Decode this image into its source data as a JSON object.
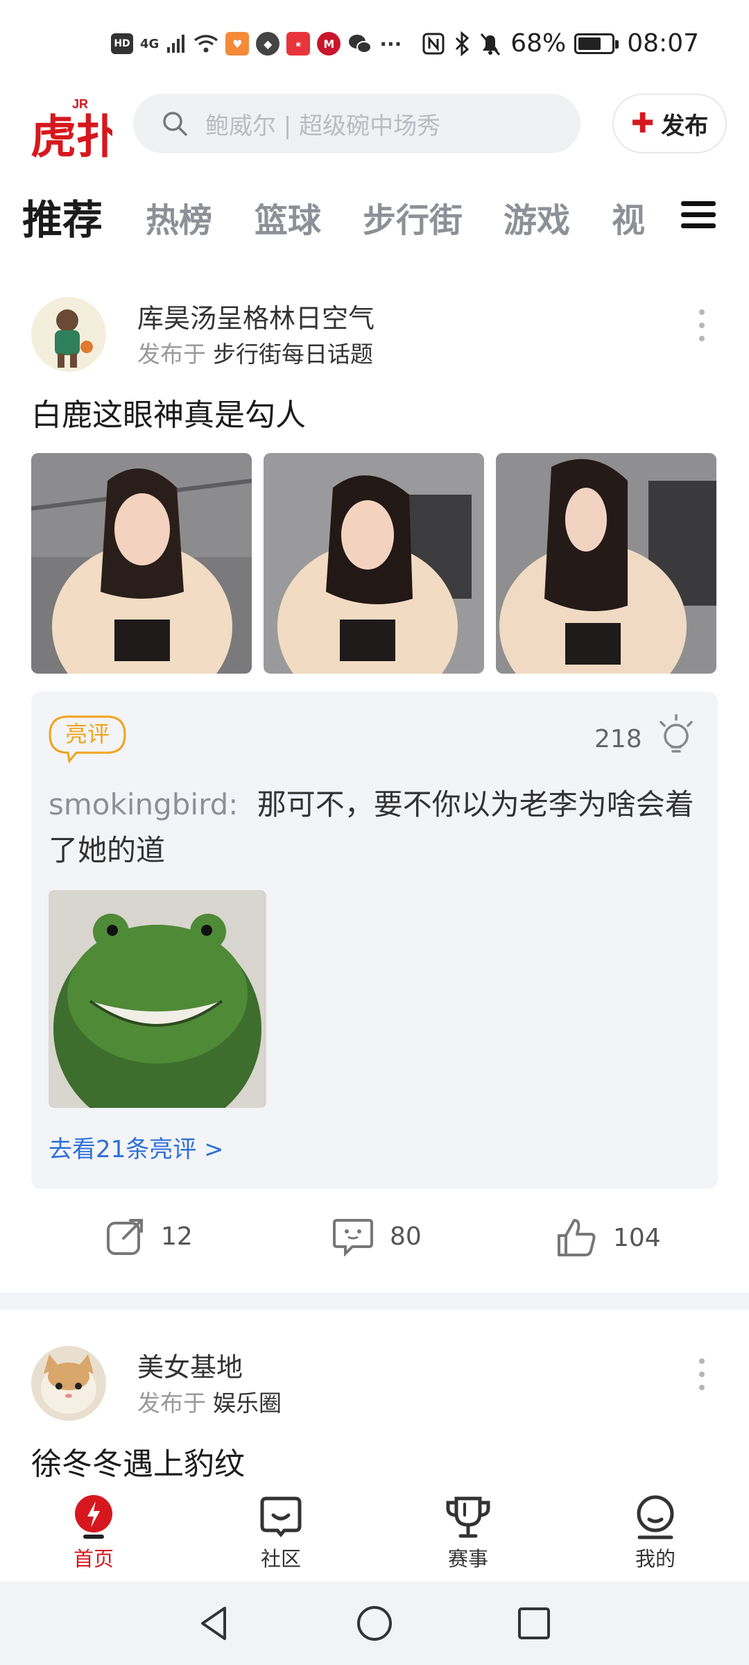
{
  "status_bar": {
    "net_label": "HD",
    "signal_label": "4G",
    "more_label": "···",
    "battery_text": "68%",
    "battery_level": 0.68,
    "time": "08:07"
  },
  "header": {
    "logo_text": "虎扑",
    "logo_small": "JR",
    "search_placeholder": "鲍威尔 | 超级碗中场秀",
    "publish_label": "发布"
  },
  "tabs": [
    {
      "label": "推荐",
      "active": true
    },
    {
      "label": "热榜"
    },
    {
      "label": "篮球"
    },
    {
      "label": "步行街"
    },
    {
      "label": "游戏"
    },
    {
      "label": "视"
    }
  ],
  "post1": {
    "author": "库昊汤呈格林日空气",
    "published_prefix": "发布于",
    "board": "步行街每日话题",
    "title": "白鹿这眼神真是勾人",
    "light_badge": "亮评",
    "light_count": "218",
    "comment_user": "smokingbird:",
    "comment_text": "那可不，要不你以为老李为啥会着了她的道",
    "more_comments": "去看21条亮评 >",
    "share_count": "12",
    "reply_count": "80",
    "like_count": "104"
  },
  "post2": {
    "author": "美女基地",
    "published_prefix": "发布于",
    "board": "娱乐圈",
    "title": "徐冬冬遇上豹纹"
  },
  "bottom_nav": [
    {
      "label": "首页",
      "icon": "home-bolt-icon",
      "active": true
    },
    {
      "label": "社区",
      "icon": "community-chat-icon"
    },
    {
      "label": "赛事",
      "icon": "trophy-icon"
    },
    {
      "label": "我的",
      "icon": "profile-icon"
    }
  ],
  "colors": {
    "brand_red": "#d6181e",
    "link_blue": "#2e6fd8",
    "badge_orange": "#f0a31c",
    "tab_inactive": "#8d9096"
  }
}
